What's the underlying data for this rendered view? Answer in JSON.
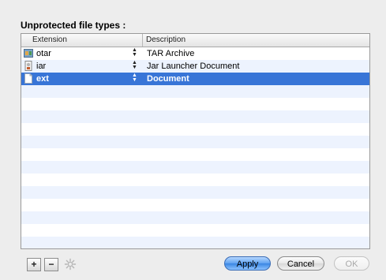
{
  "title": "Unprotected file types :",
  "table": {
    "columns": [
      "Extension",
      "Description"
    ],
    "rows": [
      {
        "extension": "otar",
        "description": "TAR Archive",
        "icon": "tar-archive-icon",
        "selected": false
      },
      {
        "extension": "iar",
        "description": "Jar Launcher Document",
        "icon": "jar-launcher-icon",
        "selected": false
      },
      {
        "extension": "ext",
        "description": "Document",
        "icon": "document-icon",
        "selected": true
      }
    ],
    "empty_row_count": 14
  },
  "toolbar": {
    "add_label": "+",
    "remove_label": "−",
    "action_icon": "gear-icon"
  },
  "buttons": {
    "apply": "Apply",
    "cancel": "Cancel",
    "ok": "OK"
  },
  "colors": {
    "selection": "#3875d7",
    "alternate_row": "#edf3fe",
    "default_button": "#5ea1f0"
  }
}
